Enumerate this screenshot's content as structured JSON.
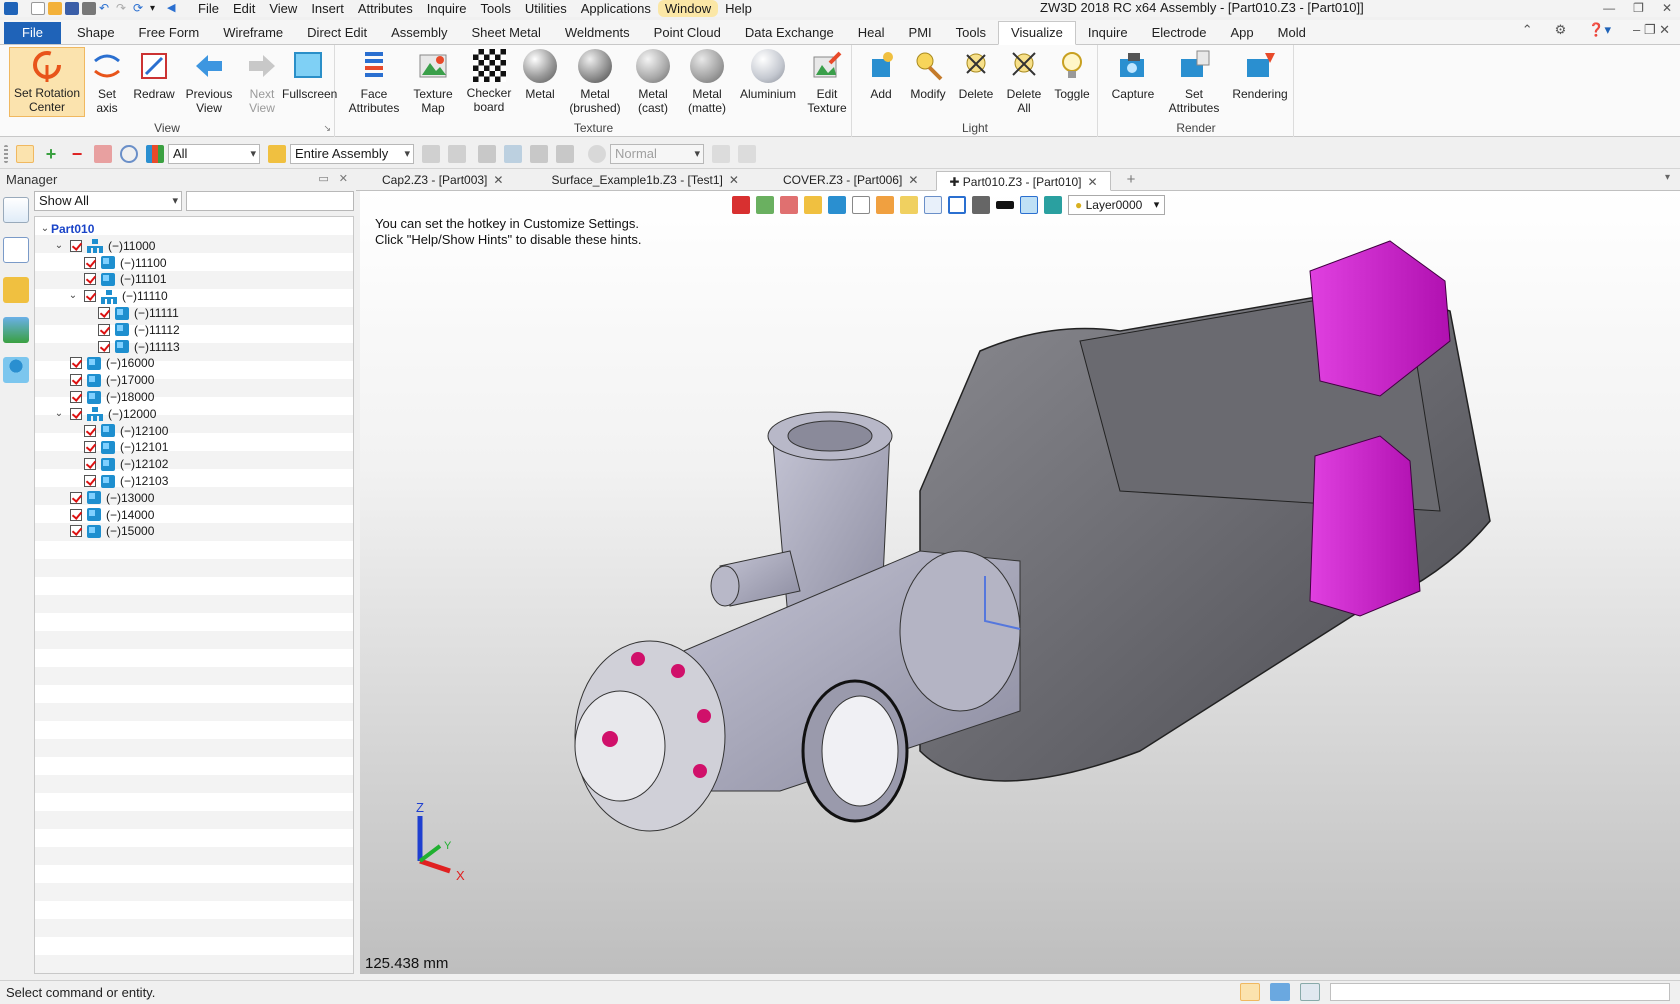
{
  "title": {
    "app": "ZW3D 2018 RC x64",
    "document": "Assembly - [Part010.Z3 - [Part010]]"
  },
  "menu": [
    "File",
    "Edit",
    "View",
    "Insert",
    "Attributes",
    "Inquire",
    "Tools",
    "Utilities",
    "Applications",
    "Window",
    "Help"
  ],
  "ribbon_tabs": [
    "File",
    "Shape",
    "Free Form",
    "Wireframe",
    "Direct Edit",
    "Assembly",
    "Sheet Metal",
    "Weldments",
    "Point Cloud",
    "Data Exchange",
    "Heal",
    "PMI",
    "Tools",
    "Visualize",
    "Inquire",
    "Electrode",
    "App",
    "Mold"
  ],
  "active_tab": "Visualize",
  "ribbon": {
    "view": {
      "label": "View",
      "buttons": [
        "Set Rotation Center",
        "Set axis",
        "Redraw",
        "Previous View",
        "Next View",
        "Fullscreen"
      ]
    },
    "texture": {
      "label": "Texture",
      "buttons": [
        "Face Attributes",
        "Texture Map",
        "Checker board",
        "Metal",
        "Metal (brushed)",
        "Metal (cast)",
        "Metal (matte)",
        "Aluminium",
        "Edit Texture"
      ]
    },
    "light": {
      "label": "Light",
      "buttons": [
        "Add",
        "Modify",
        "Delete",
        "Delete All",
        "Toggle"
      ]
    },
    "render": {
      "label": "Render",
      "buttons": [
        "Capture",
        "Set Attributes",
        "Rendering"
      ]
    }
  },
  "toolbar": {
    "filter": "All",
    "scope": "Entire Assembly",
    "mode": "Normal"
  },
  "manager": {
    "title": "Manager",
    "filter": "Show All",
    "search_placeholder": "",
    "tree": [
      {
        "label": "Part010",
        "level": 0,
        "type": "root",
        "expanded": true
      },
      {
        "label": "(−)11000",
        "level": 1,
        "type": "assembly",
        "expanded": true
      },
      {
        "label": "(−)11100",
        "level": 2,
        "type": "part"
      },
      {
        "label": "(−)11101",
        "level": 2,
        "type": "part"
      },
      {
        "label": "(−)11110",
        "level": 2,
        "type": "assembly",
        "expanded": true
      },
      {
        "label": "(−)11111",
        "level": 3,
        "type": "part"
      },
      {
        "label": "(−)11112",
        "level": 3,
        "type": "part"
      },
      {
        "label": "(−)11113",
        "level": 3,
        "type": "part"
      },
      {
        "label": "(−)16000",
        "level": 1,
        "type": "part"
      },
      {
        "label": "(−)17000",
        "level": 1,
        "type": "part"
      },
      {
        "label": "(−)18000",
        "level": 1,
        "type": "part"
      },
      {
        "label": "(−)12000",
        "level": 1,
        "type": "assembly",
        "expanded": true
      },
      {
        "label": "(−)12100",
        "level": 2,
        "type": "part"
      },
      {
        "label": "(−)12101",
        "level": 2,
        "type": "part"
      },
      {
        "label": "(−)12102",
        "level": 2,
        "type": "part"
      },
      {
        "label": "(−)12103",
        "level": 2,
        "type": "part"
      },
      {
        "label": "(−)13000",
        "level": 1,
        "type": "part"
      },
      {
        "label": "(−)14000",
        "level": 1,
        "type": "part"
      },
      {
        "label": "(−)15000",
        "level": 1,
        "type": "part"
      }
    ]
  },
  "doc_tabs": [
    {
      "label": "Cap2.Z3 - [Part003]",
      "active": false
    },
    {
      "label": "Surface_Example1b.Z3 - [Test1]",
      "active": false
    },
    {
      "label": "COVER.Z3 - [Part006]",
      "active": false
    },
    {
      "label": "Part010.Z3 - [Part010]",
      "active": true
    }
  ],
  "viewport": {
    "layer": "Layer0000",
    "hint_line1": "You can set the hotkey in Customize Settings.",
    "hint_line2": "Click \"Help/Show Hints\" to disable these hints.",
    "scale": "125.438 mm",
    "axes": {
      "x": "X",
      "y": "Y",
      "z": "Z"
    }
  },
  "status": {
    "text": "Select command or entity."
  },
  "colors": {
    "accent": "#1f63b8",
    "model_body": "#a8a8ba",
    "model_magenta": "#d21ad2",
    "highlight": "#fbe3ae"
  }
}
